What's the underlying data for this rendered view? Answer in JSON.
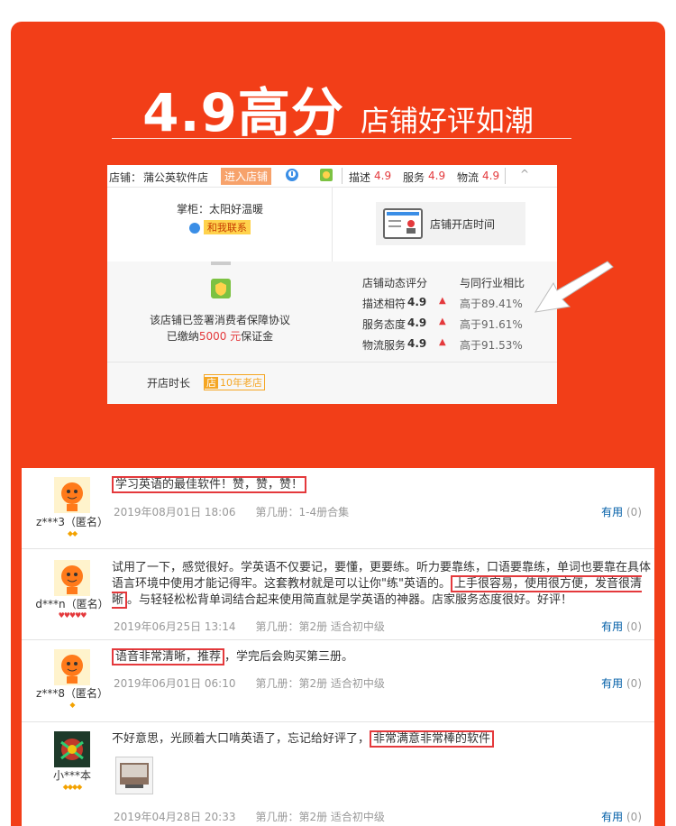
{
  "hero": {
    "big": "4.9高分",
    "small": "店铺好评如潮"
  },
  "shop": {
    "label": "店铺：",
    "name": "蒲公英软件店",
    "enter": "进入店铺",
    "desc_label": "描述",
    "desc_value": "4.9",
    "service_label": "服务",
    "service_value": "4.9",
    "logistics_label": "物流",
    "logistics_value": "4.9",
    "caret": "^",
    "owner": "掌柜：太阳好温暖",
    "contact": "和我联系",
    "open_time": "店铺开店时间",
    "agreement": "该店铺已签署消费者保障协议",
    "deposit_pre": "已缴纳",
    "deposit_amount": "5000 元",
    "deposit_post": "保证金",
    "dyn_title": "店铺动态评分",
    "compare_title": "与同行业相比",
    "rows": [
      {
        "label": "描述相符",
        "score": "4.9",
        "compare": "高于89.41%"
      },
      {
        "label": "服务态度",
        "score": "4.9",
        "compare": "高于91.61%"
      },
      {
        "label": "物流服务",
        "score": "4.9",
        "compare": "高于91.53%"
      }
    ],
    "age_label": "开店时长",
    "age_icon": "店",
    "age_value": "10年老店",
    "colors": {
      "accent": "#f23e18",
      "score": "#e4393c"
    }
  },
  "reviews": [
    {
      "user": "z***3（匿名）",
      "text_hl1": "学习英语的最佳软件！赞，赞，赞！",
      "date": "2019年08月01日 18:06",
      "volume": "第几册：1-4册合集",
      "useful_label": "有用",
      "useful_count": "(0)"
    },
    {
      "user": "d***n（匿名）",
      "text_a": "试用了一下，感觉很好。学英语不仅要记，要懂，更要练。听力要靠练，口语要靠练，单词也要靠在具体语言环境中使用才能记得牢。这套教材就是可以让你\"练\"英语的。",
      "text_hl1": "上手很容易，使用很方便，发音很清晰",
      "text_b": "。与轻轻松松背单词结合起来使用简直就是学英语的神器。店家服务态度很好。好评！",
      "date": "2019年06月25日 13:14",
      "volume": "第几册：第2册 适合初中级",
      "useful_label": "有用",
      "useful_count": "(0)"
    },
    {
      "user": "z***8（匿名）",
      "text_hl1": "语音非常清晰，推荐",
      "text_b": "，学完后会购买第三册。",
      "date": "2019年06月01日 06:10",
      "volume": "第几册：第2册 适合初中级",
      "useful_label": "有用",
      "useful_count": "(0)"
    },
    {
      "user": "小***本",
      "text_a": "不好意思，光顾着大口啃英语了，忘记给好评了，",
      "text_hl1": "非常满意非常棒的软件",
      "date": "2019年04月28日 20:33",
      "volume": "第几册：第2册 适合初中级",
      "useful_label": "有用",
      "useful_count": "(0)"
    }
  ]
}
